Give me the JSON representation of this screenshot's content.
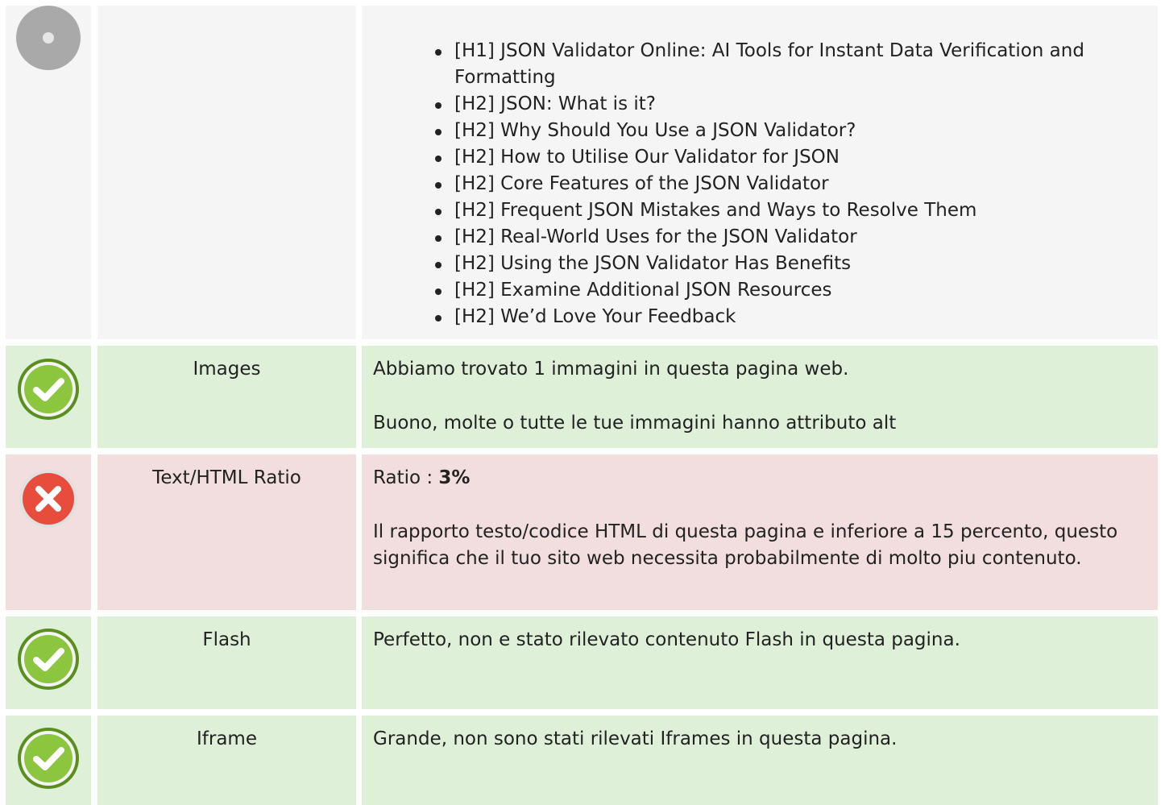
{
  "headings_section": {
    "items": [
      "[H1] JSON Validator Online: AI Tools for Instant Data Verification and Formatting",
      "[H2] JSON: What is it?",
      "[H2] Why Should You Use a JSON Validator?",
      "[H2] How to Utilise Our Validator for JSON",
      "[H2] Core Features of the JSON Validator",
      "[H2] Frequent JSON Mistakes and Ways to Resolve Them",
      "[H2] Real-World Uses for the JSON Validator",
      "[H2] Using the JSON Validator Has Benefits",
      "[H2] Examine Additional JSON Resources",
      "[H2] We’d Love Your Feedback"
    ]
  },
  "images": {
    "label": "Images",
    "status": "good",
    "line1": "Abbiamo trovato 1 immagini in questa pagina web.",
    "line2": "Buono, molte o tutte le tue immagini hanno attributo alt"
  },
  "ratio": {
    "label": "Text/HTML Ratio",
    "status": "bad",
    "prefix": "Ratio : ",
    "value": "3%",
    "description": "Il rapporto testo/codice HTML di questa pagina e inferiore a 15 percento, questo significa che il tuo sito web necessita probabilmente di molto piu contenuto."
  },
  "flash": {
    "label": "Flash",
    "status": "good",
    "text": "Perfetto, non e stato rilevato contenuto Flash in questa pagina."
  },
  "iframe": {
    "label": "Iframe",
    "status": "good",
    "text": "Grande, non sono stati rilevati Iframes in questa pagina."
  },
  "colors": {
    "good_bg": "#dff0d8",
    "bad_bg": "#f2dede",
    "neutral_bg": "#f5f5f5",
    "check_green": "#8cc63f",
    "error_red": "#e74c3c"
  }
}
